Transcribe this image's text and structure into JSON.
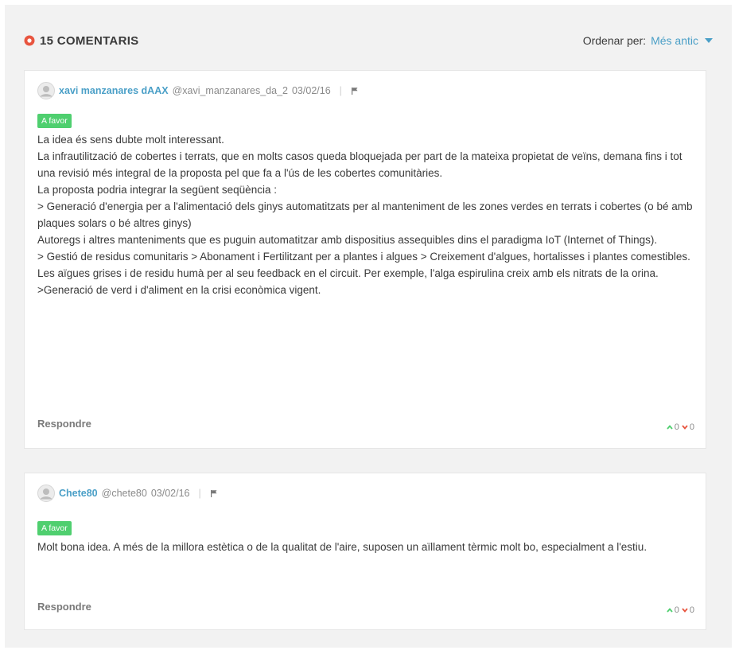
{
  "header": {
    "count_label": "15 COMENTARIS",
    "sort_label": "Ordenar per:",
    "sort_value": "Més antic"
  },
  "colors": {
    "accent": "#4a9fc7",
    "count_icon": "#e8553f",
    "badge": "#4fcf6f",
    "upvote": "#4fcf6f",
    "downvote": "#e8553f"
  },
  "comments": [
    {
      "author": "xavi manzanares dAAX",
      "handle": "@xavi_manzanares_da_2",
      "date": "03/02/16",
      "badge": "A favor",
      "lines": [
        "La idea és sens dubte molt interessant.",
        "La infrautilització de cobertes i terrats, que en molts casos queda bloquejada per part de la mateixa propietat de veïns, demana fins i tot una revisió més integral de la proposta pel que fa a l'ús de les cobertes comunitàries.",
        "La proposta podria integrar la següent seqüència :",
        "> Generació d'energia per a l'alimentació dels ginys automatitzats per al manteniment de les zones verdes en terrats i cobertes (o bé amb plaques solars o bé altres ginys)",
        "Autoregs i altres manteniments que es puguin automatitzar amb dispositius assequibles dins el paradigma IoT (Internet of Things).",
        "> Gestió de residus comunitaris > Abonament i Fertilitzant per a plantes i algues > Creixement d'algues, hortalisses i plantes comestibles.",
        "Les aïgues grises i de residu humà per al seu feedback en el circuit. Per exemple, l'alga espirulina creix amb els nitrats de la orina.",
        ">Generació de verd i d'aliment en la crisi econòmica vigent."
      ],
      "reply_label": "Respondre",
      "up_count": "0",
      "down_count": "0"
    },
    {
      "author": "Chete80",
      "handle": "@chete80",
      "date": "03/02/16",
      "badge": "A favor",
      "lines": [
        "Molt bona idea. A més de la millora estètica o de la qualitat de l'aire, suposen un aïllament tèrmic molt bo, especialment a l'estiu."
      ],
      "reply_label": "Respondre",
      "up_count": "0",
      "down_count": "0"
    }
  ]
}
